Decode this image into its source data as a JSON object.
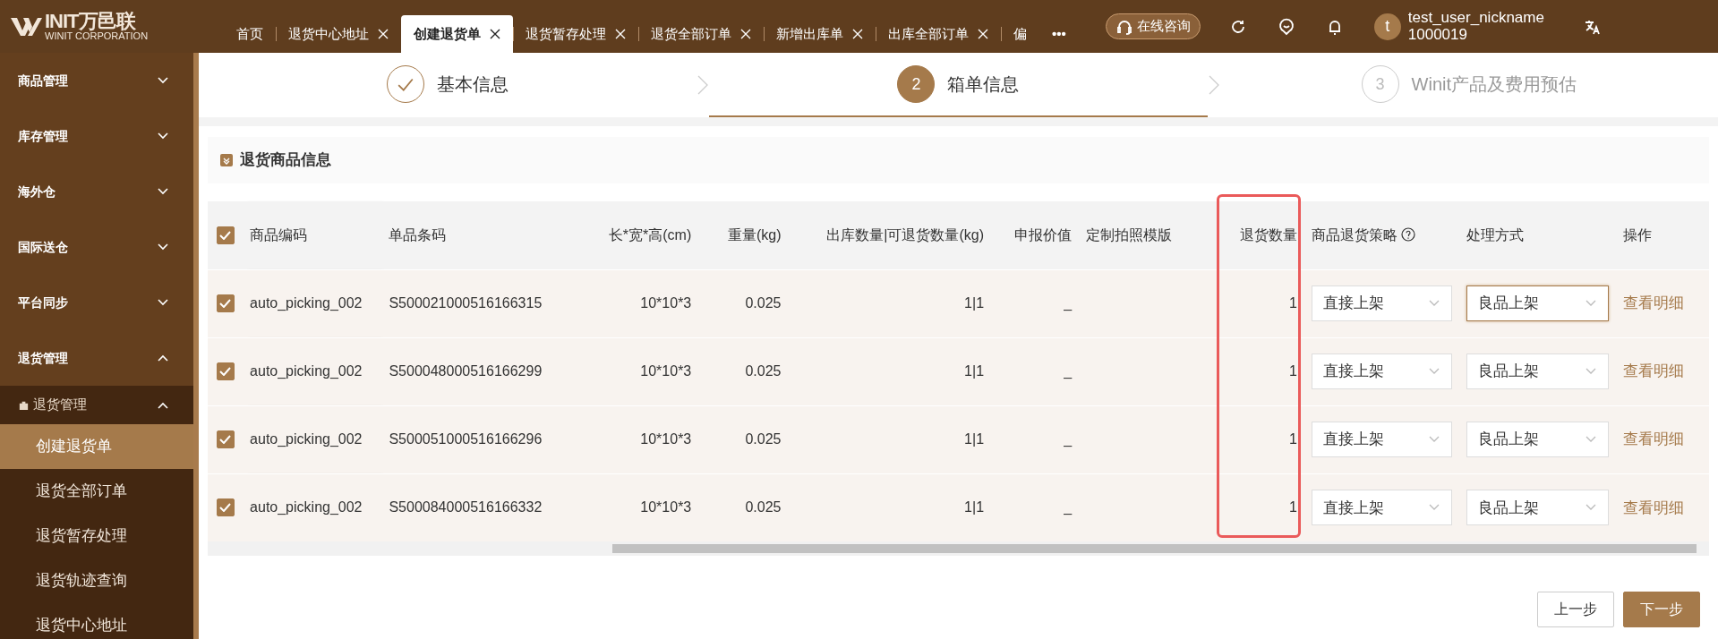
{
  "header": {
    "logo_text": "INIT万邑联",
    "logo_sub": "WINIT CORPORATION",
    "tabs": [
      {
        "label": "首页",
        "closable": false,
        "selected": false
      },
      {
        "label": "退货中心地址",
        "closable": true,
        "selected": false
      },
      {
        "label": "创建退货单",
        "closable": true,
        "selected": true
      },
      {
        "label": "退货暂存处理",
        "closable": true,
        "selected": false
      },
      {
        "label": "退货全部订单",
        "closable": true,
        "selected": false
      },
      {
        "label": "新增出库单",
        "closable": true,
        "selected": false
      },
      {
        "label": "出库全部订单",
        "closable": true,
        "selected": false
      },
      {
        "label": "偏",
        "closable": false,
        "selected": false
      }
    ],
    "more": "•••",
    "consult": "在线咨询",
    "user_name": "test_user_nickname",
    "user_id": "1000019",
    "avatar_letter": "t"
  },
  "sidebar": [
    {
      "label": "商品管理",
      "expanded": false
    },
    {
      "label": "库存管理",
      "expanded": false
    },
    {
      "label": "海外仓",
      "expanded": false
    },
    {
      "label": "国际送仓",
      "expanded": false
    },
    {
      "label": "平台同步",
      "expanded": false
    },
    {
      "label": "退货管理",
      "expanded": true,
      "children": [
        {
          "label": "退货管理",
          "expanded": true,
          "children": [
            {
              "label": "创建退货单",
              "selected": true
            },
            {
              "label": "退货全部订单",
              "selected": false
            },
            {
              "label": "退货暂存处理",
              "selected": false
            },
            {
              "label": "退货轨迹查询",
              "selected": false
            },
            {
              "label": "退货中心地址",
              "selected": false
            }
          ]
        }
      ]
    }
  ],
  "steps": [
    {
      "label": "基本信息",
      "completed": true,
      "selected": false
    },
    {
      "number": "2",
      "label": "箱单信息",
      "completed": false,
      "selected": true
    },
    {
      "number": "3",
      "label": "Winit产品及费用预估",
      "completed": false,
      "selected": false
    }
  ],
  "section_title": "退货商品信息",
  "table": {
    "all_checked": true,
    "columns": [
      {
        "label": "商品编码",
        "highlighted": false
      },
      {
        "label": "单品条码",
        "highlighted": false
      },
      {
        "label": "长*宽*高(cm)",
        "highlighted": false
      },
      {
        "label": "重量(kg)",
        "highlighted": false
      },
      {
        "label": "出库数量|可退货数量(kg)",
        "highlighted": false
      },
      {
        "label": "申报价值",
        "highlighted": false
      },
      {
        "label": "定制拍照模版",
        "highlighted": false
      },
      {
        "label": "退货数量",
        "highlighted": true
      },
      {
        "label": "商品退货策略",
        "highlighted": false,
        "help": true
      },
      {
        "label": "处理方式",
        "highlighted": false
      },
      {
        "label": "操作",
        "highlighted": false
      }
    ],
    "rows": [
      {
        "checked": true,
        "code": "auto_picking_002",
        "barcode": "S500021000516166315",
        "dims": "10*10*3",
        "weight": "0.025",
        "qty": "1|1",
        "declared": "_",
        "return_qty": "1",
        "strategy": "直接上架",
        "handling": "良品上架",
        "handling_focused": true,
        "action": "查看明细"
      },
      {
        "checked": true,
        "code": "auto_picking_002",
        "barcode": "S500048000516166299",
        "dims": "10*10*3",
        "weight": "0.025",
        "qty": "1|1",
        "declared": "_",
        "return_qty": "1",
        "strategy": "直接上架",
        "handling": "良品上架",
        "handling_focused": false,
        "action": "查看明细"
      },
      {
        "checked": true,
        "code": "auto_picking_002",
        "barcode": "S500051000516166296",
        "dims": "10*10*3",
        "weight": "0.025",
        "qty": "1|1",
        "declared": "_",
        "return_qty": "1",
        "strategy": "直接上架",
        "handling": "良品上架",
        "handling_focused": false,
        "action": "查看明细"
      },
      {
        "checked": true,
        "code": "auto_picking_002",
        "barcode": "S500084000516166332",
        "dims": "10*10*3",
        "weight": "0.025",
        "qty": "1|1",
        "declared": "_",
        "return_qty": "1",
        "strategy": "直接上架",
        "handling": "良品上架",
        "handling_focused": false,
        "action": "查看明细"
      }
    ]
  },
  "buttons": [
    {
      "label": "上一步",
      "kind": "secondary"
    },
    {
      "label": "下一步",
      "kind": "primary"
    }
  ]
}
